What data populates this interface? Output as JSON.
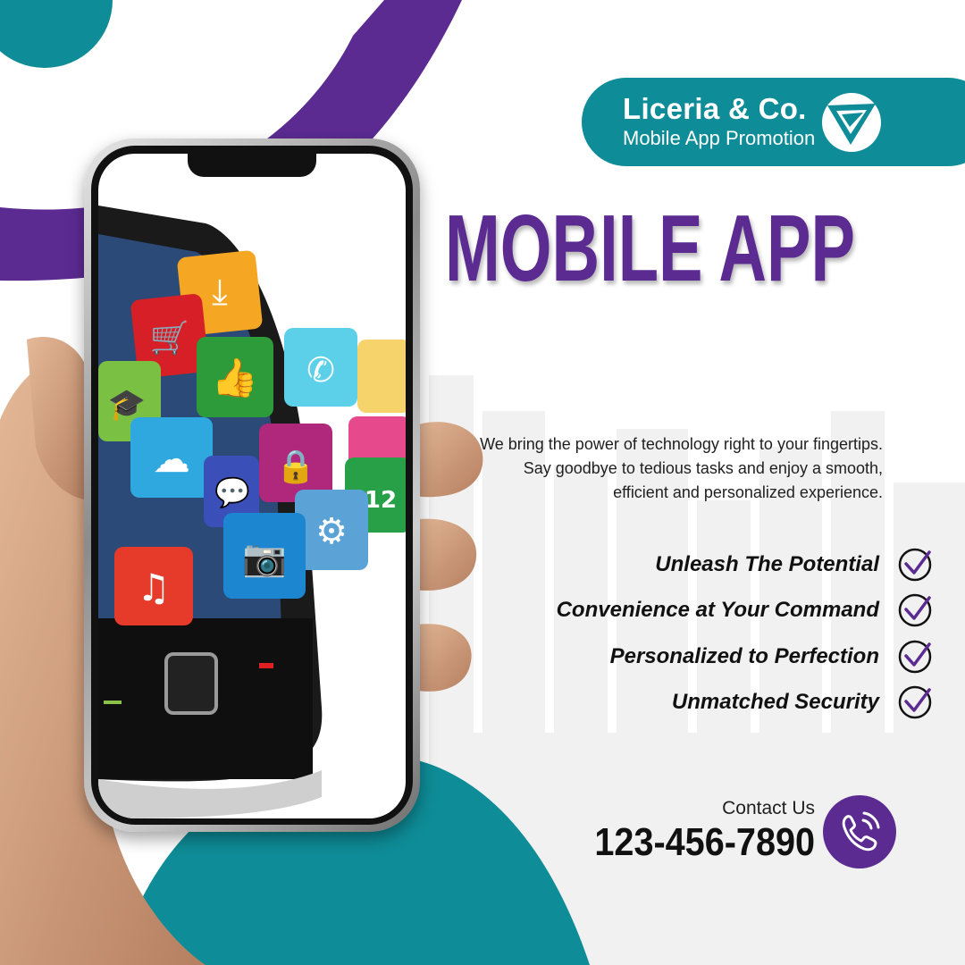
{
  "brand": {
    "name": "Liceria & Co.",
    "tagline": "Mobile App Promotion"
  },
  "headline": "MOBILE APP",
  "description": "We bring the power of technology right to your fingertips. Say goodbye to tedious tasks and enjoy a smooth, efficient and personalized experience.",
  "features": [
    {
      "label": "Unleash The Potential",
      "icon": "check-circle-icon"
    },
    {
      "label": "Convenience at Your Command",
      "icon": "check-circle-icon"
    },
    {
      "label": "Personalized to Perfection",
      "icon": "check-circle-icon"
    },
    {
      "label": "Unmatched Security",
      "icon": "check-circle-icon"
    }
  ],
  "contact": {
    "label": "Contact Us",
    "phone": "123-456-7890",
    "icon": "phone-call-icon"
  },
  "colors": {
    "purple": "#5b2b91",
    "teal": "#0e8c97",
    "text": "#1f1f1f"
  }
}
